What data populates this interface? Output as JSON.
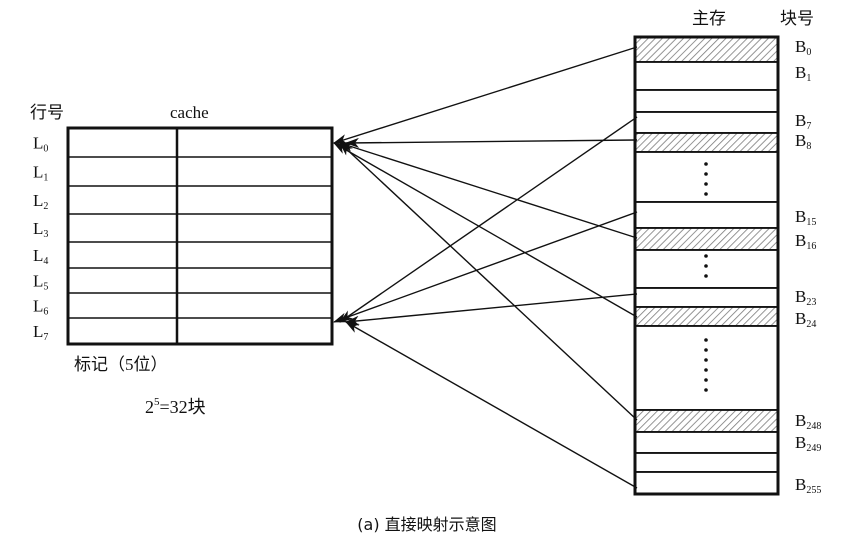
{
  "cache": {
    "title": "cache",
    "row_header": "行号",
    "rows": [
      {
        "base": "L",
        "sub": "0"
      },
      {
        "base": "L",
        "sub": "1"
      },
      {
        "base": "L",
        "sub": "2"
      },
      {
        "base": "L",
        "sub": "3"
      },
      {
        "base": "L",
        "sub": "4"
      },
      {
        "base": "L",
        "sub": "5"
      },
      {
        "base": "L",
        "sub": "6"
      },
      {
        "base": "L",
        "sub": "7"
      }
    ],
    "tag_label": "标记（5位）",
    "formula": {
      "base": "2",
      "exp": "5",
      "rest": "=32块"
    }
  },
  "memory": {
    "title": "主存",
    "block_header": "块号",
    "blocks": [
      {
        "base": "B",
        "sub": "0",
        "hatched": true
      },
      {
        "base": "B",
        "sub": "1",
        "hatched": false
      },
      {
        "base": "",
        "sub": "",
        "hatched": false
      },
      {
        "base": "B",
        "sub": "7",
        "hatched": false
      },
      {
        "base": "B",
        "sub": "8",
        "hatched": true
      },
      {
        "base": "",
        "sub": "",
        "hatched": false
      },
      {
        "base": "B",
        "sub": "15",
        "hatched": false
      },
      {
        "base": "B",
        "sub": "16",
        "hatched": true
      },
      {
        "base": "",
        "sub": "",
        "hatched": false
      },
      {
        "base": "B",
        "sub": "23",
        "hatched": false
      },
      {
        "base": "B",
        "sub": "24",
        "hatched": true
      },
      {
        "base": "",
        "sub": "",
        "hatched": false
      },
      {
        "base": "B",
        "sub": "248",
        "hatched": true
      },
      {
        "base": "B",
        "sub": "249",
        "hatched": false
      },
      {
        "base": "",
        "sub": "",
        "hatched": false
      },
      {
        "base": "B",
        "sub": "255",
        "hatched": false
      }
    ]
  },
  "mappings": [
    {
      "from_block": "B0",
      "to_line": "L0"
    },
    {
      "from_block": "B7",
      "to_line": "L7"
    },
    {
      "from_block": "B8",
      "to_line": "L0"
    },
    {
      "from_block": "B15",
      "to_line": "L7"
    },
    {
      "from_block": "B16",
      "to_line": "L0"
    },
    {
      "from_block": "B23",
      "to_line": "L7"
    },
    {
      "from_block": "B24",
      "to_line": "L0"
    },
    {
      "from_block": "B248",
      "to_line": "L0"
    },
    {
      "from_block": "B255",
      "to_line": "L7"
    }
  ],
  "caption": "(a) 直接映射示意图"
}
